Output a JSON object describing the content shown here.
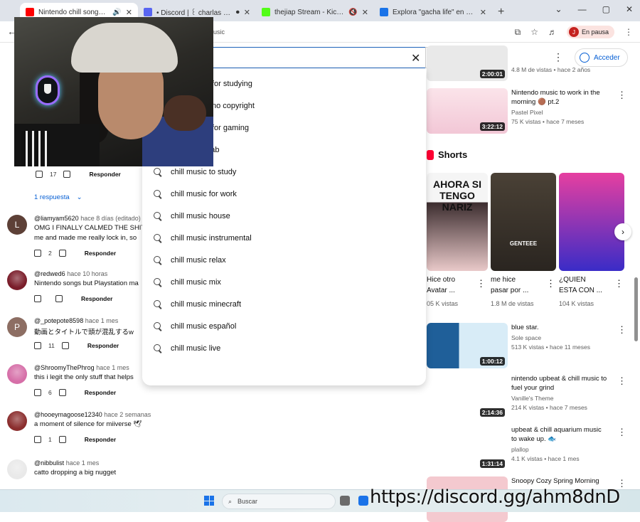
{
  "browser": {
    "tabs": [
      {
        "title": "Nintendo chill songs to listen to",
        "active": true,
        "favicon_color": "#ff0000",
        "extra": "🔊"
      },
      {
        "title": "• Discord | ꒰ charlas | ʃ.ʃʌ",
        "active": false,
        "favicon_color": "#5865f2",
        "extra": "⏺"
      },
      {
        "title": "thejiap Stream - Kick Dashboard",
        "active": false,
        "favicon_color": "#53fc18",
        "extra": "🔇"
      },
      {
        "title": "Explora \"gacha life\" en Roblox",
        "active": false,
        "favicon_color": "#1a73e8",
        "extra": ""
      }
    ],
    "url_fragment": "usic",
    "profile_initial": "J",
    "profile_status": "En pausa"
  },
  "youtube": {
    "sign_in_label": "Acceder",
    "suggestions": [
      {
        "prefix": "chill music ",
        "suffix": "for studying",
        "partial": true
      },
      {
        "prefix": "chill music ",
        "suffix": "no copyright",
        "partial": true
      },
      {
        "prefix": "chill music ",
        "suffix": "for gaming",
        "partial": true
      },
      {
        "prefix": "chill music ",
        "suffix": "lab"
      },
      {
        "prefix": "chill music ",
        "suffix": "to study"
      },
      {
        "prefix": "chill music ",
        "suffix": "for work"
      },
      {
        "prefix": "chill music ",
        "suffix": "house"
      },
      {
        "prefix": "chill music ",
        "suffix": "instrumental"
      },
      {
        "prefix": "chill music ",
        "suffix": "relax"
      },
      {
        "prefix": "chill music ",
        "suffix": "mix"
      },
      {
        "prefix": "chill music ",
        "suffix": "minecraft"
      },
      {
        "prefix": "chill music ",
        "suffix": "español"
      },
      {
        "prefix": "chill music ",
        "suffix": "live"
      }
    ]
  },
  "comments": {
    "first_likes": "17",
    "reply_label": "Responder",
    "replies_toggle": "1 respuesta",
    "items": [
      {
        "avatar": "L",
        "avatar_color": "#5d4037",
        "user": "@liamyam5620",
        "time": "hace 8 días (editado)",
        "lines": [
          "OMG I FINALLY CALMED THE SHIT",
          "me and made me really lock in, so"
        ],
        "likes": "2"
      },
      {
        "avatar": "",
        "avatar_color": "#7a1d2a",
        "user": "@redwed6",
        "time": "hace 10 horas",
        "lines": [
          "Nintendo songs but Playstation ma"
        ],
        "likes": ""
      },
      {
        "avatar": "P",
        "avatar_color": "#8d6e63",
        "user": "@_potepote8598",
        "time": "hace 1 mes",
        "lines": [
          "動画とタイトルで頭が混乱するw"
        ],
        "likes": "11"
      },
      {
        "avatar": "",
        "avatar_color": "#d66fa8",
        "user": "@ShroomyThePhrog",
        "time": "hace 1 mes",
        "lines": [
          "this i legit the only stuff that helps"
        ],
        "likes": "6"
      },
      {
        "avatar": "",
        "avatar_color": "#8b2e2e",
        "user": "@hooeymagoose12340",
        "time": "hace 2 semanas",
        "lines": [
          "a moment of silence for miiverse 🕊"
        ],
        "likes": "1"
      },
      {
        "avatar": "",
        "avatar_color": "#e9e9e9",
        "user": "@nibbulist",
        "time": "hace 1 mes",
        "lines": [
          "catto dropping a big nugget"
        ],
        "likes": ""
      }
    ]
  },
  "sidebar_videos": {
    "top_partial": {
      "stats": "4.8 M de vistas • hace 2 años",
      "duration": "2:00:01"
    },
    "items": [
      {
        "title_lines": [
          "Nintendo music to work in the",
          "morning 🟤 pt.2"
        ],
        "channel": "Pastel Pixel",
        "stats": "75 K vistas • hace 7 meses",
        "duration": "3:22:12",
        "thumb": "#f6d7e2"
      },
      {
        "title_lines": [
          "blue star."
        ],
        "channel": "Sole space",
        "stats": "513 K vistas • hace 11 meses",
        "duration": "1:00:12",
        "thumb": "#2f6fa8"
      },
      {
        "title_lines": [
          "nintendo upbeat & chill music to",
          "fuel your grind"
        ],
        "channel": "Vanille's Theme",
        "stats": "214 K vistas • hace 7 meses",
        "duration": "2:14:36",
        "thumb": "#ffffff"
      },
      {
        "title_lines": [
          "upbeat & chill  aquarium music",
          "to wake up. 🐟"
        ],
        "channel": "plallop",
        "stats": "4.1 K vistas • hace 1 mes",
        "duration": "1:31:14",
        "thumb": "#ffffff"
      },
      {
        "title_lines": [
          "Snoopy Cozy Spring Morning"
        ],
        "channel": "",
        "stats": "",
        "duration": "",
        "thumb": "#f4c9cf"
      }
    ],
    "shorts_label": "Shorts",
    "shorts": [
      {
        "title_lines": [
          "Hice otro",
          "Avatar ..."
        ],
        "views": "05 K vistas",
        "thumb_text": "AHORA SI TENGO NARIZ"
      },
      {
        "title_lines": [
          "me hice",
          "pasar por ..."
        ],
        "views": "1.8 M de vistas",
        "thumb_text": "GENTEEE"
      },
      {
        "title_lines": [
          "¿QUIEN",
          "ESTA CON ..."
        ],
        "views": "104 K vistas",
        "thumb_text": ""
      }
    ]
  },
  "taskbar": {
    "search_placeholder": "Buscar",
    "overlay_text": "https://discord.gg/ahm8dnD",
    "tray_time": "",
    "tray_date": ""
  }
}
